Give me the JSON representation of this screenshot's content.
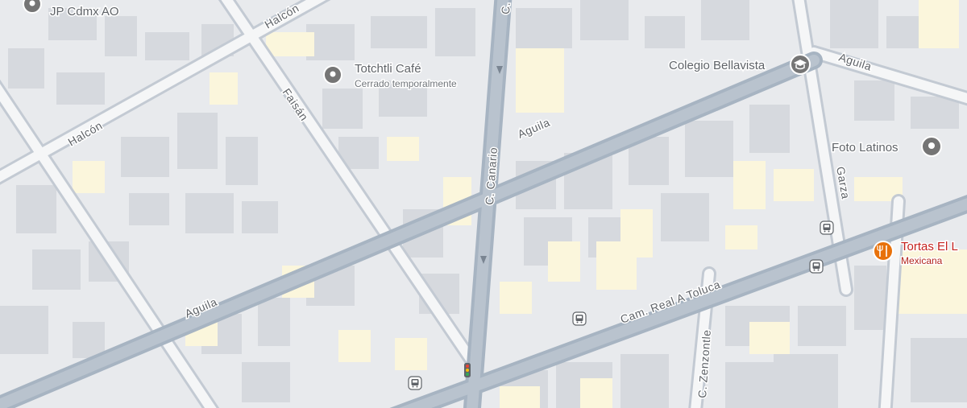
{
  "map": {
    "colors": {
      "background": "#e8eaed",
      "building": "#d6d9de",
      "building_alt": "#dcdfe3",
      "highlight_block": "#fbf6dc",
      "road_fill": "#ffffff",
      "road_casing": "#aeb8c4",
      "major_road": "#a7b4c2",
      "poi_gray": "#757575",
      "poi_food": "#e8710a",
      "transit": "#5f6368"
    },
    "streets": {
      "halcon_top": "Halcón",
      "halcon_left": "Halcón",
      "faisan": "Faisán",
      "canario_top": "C.",
      "canario": "C. Canario",
      "aguila_center": "Aguila",
      "aguila_left": "Aguila",
      "aguila_right": "Aguila",
      "garza": "Garza",
      "cam_real": "Cam. Real A Toluca",
      "zenzontle": "C. Zenzontle"
    },
    "pois": {
      "jp_cdmx": {
        "name": "JP Cdmx AO",
        "icon": "place-pin-icon"
      },
      "totchtli": {
        "name": "Totchtli Café",
        "subtitle": "Cerrado temporalmente",
        "icon": "place-pin-icon"
      },
      "bellavista": {
        "name": "Colegio Bellavista",
        "icon": "school-icon"
      },
      "foto_latinos": {
        "name": "Foto Latinos",
        "icon": "place-pin-icon"
      },
      "tortas": {
        "name": "Tortas El L",
        "subtitle": "Mexicana",
        "icon": "restaurant-icon"
      }
    },
    "icons": {
      "bus_stops": [
        "bus-stop-icon",
        "bus-stop-icon",
        "bus-stop-icon",
        "bus-stop-icon"
      ],
      "traffic_light": "traffic-light-icon",
      "oneway": "oneway-arrow-icon"
    }
  }
}
